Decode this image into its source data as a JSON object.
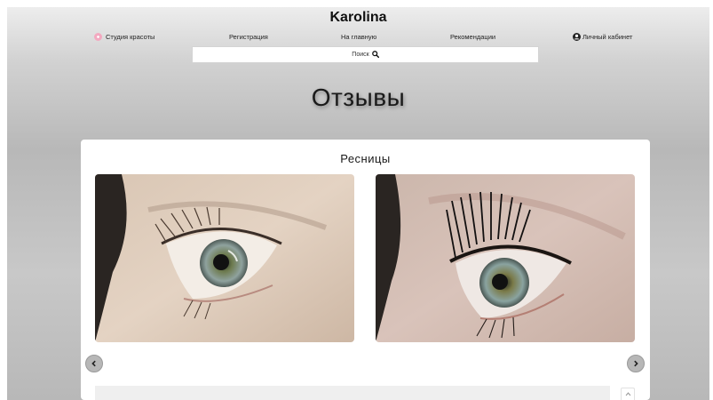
{
  "header": {
    "site_title": "Karolina",
    "brand_label": "Студия красоты",
    "nav": {
      "register": "Регистрация",
      "home": "На главную",
      "recommendations": "Рекомендации",
      "account": "Личный кабинет"
    },
    "search_label": "Поиск"
  },
  "page": {
    "title": "Отзывы"
  },
  "review_card": {
    "title": "Ресницы",
    "images": [
      "before-eyelash-photo",
      "after-eyelash-photo"
    ],
    "prev_icon": "chevron-left-icon",
    "next_icon": "chevron-right-icon"
  },
  "colors": {
    "background_gradient": [
      "#ededed",
      "#b8b8b8"
    ],
    "card": "#ffffff",
    "arrow_button": "#b7b7b7"
  }
}
